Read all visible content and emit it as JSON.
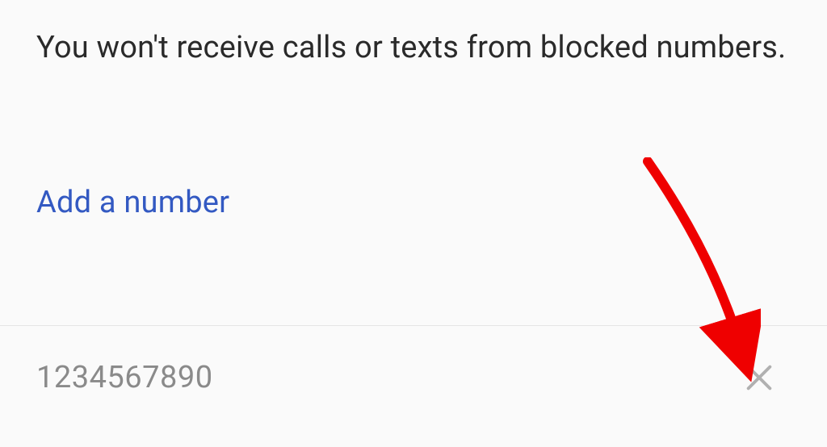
{
  "description": "You won't receive calls or texts from blocked numbers.",
  "addNumberLabel": "Add a number",
  "blockedNumbers": [
    {
      "number": "1234567890"
    }
  ]
}
